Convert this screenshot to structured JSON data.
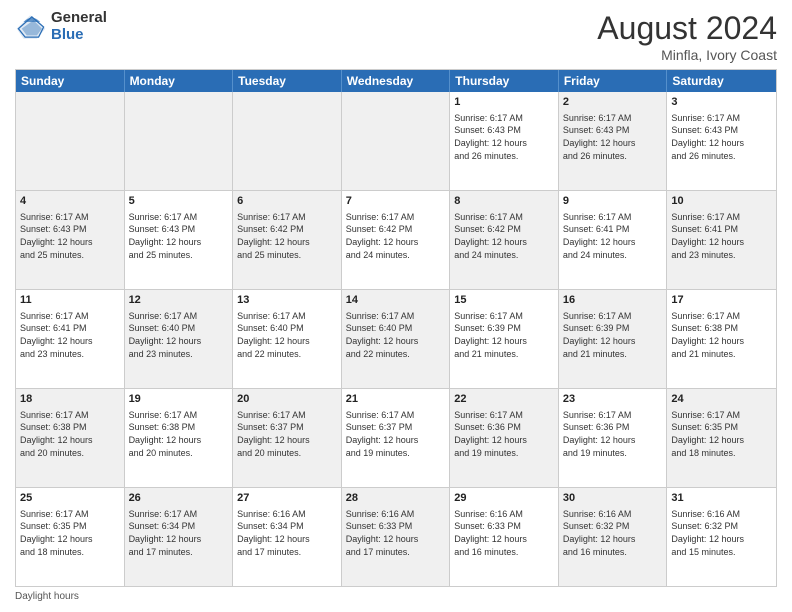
{
  "header": {
    "logo_general": "General",
    "logo_blue": "Blue",
    "title": "August 2024",
    "location": "Minfla, Ivory Coast"
  },
  "days_of_week": [
    "Sunday",
    "Monday",
    "Tuesday",
    "Wednesday",
    "Thursday",
    "Friday",
    "Saturday"
  ],
  "weeks": [
    [
      {
        "day": "",
        "info": "",
        "shaded": true
      },
      {
        "day": "",
        "info": "",
        "shaded": true
      },
      {
        "day": "",
        "info": "",
        "shaded": true
      },
      {
        "day": "",
        "info": "",
        "shaded": true
      },
      {
        "day": "1",
        "info": "Sunrise: 6:17 AM\nSunset: 6:43 PM\nDaylight: 12 hours\nand 26 minutes.",
        "shaded": false
      },
      {
        "day": "2",
        "info": "Sunrise: 6:17 AM\nSunset: 6:43 PM\nDaylight: 12 hours\nand 26 minutes.",
        "shaded": true
      },
      {
        "day": "3",
        "info": "Sunrise: 6:17 AM\nSunset: 6:43 PM\nDaylight: 12 hours\nand 26 minutes.",
        "shaded": false
      }
    ],
    [
      {
        "day": "4",
        "info": "Sunrise: 6:17 AM\nSunset: 6:43 PM\nDaylight: 12 hours\nand 25 minutes.",
        "shaded": true
      },
      {
        "day": "5",
        "info": "Sunrise: 6:17 AM\nSunset: 6:43 PM\nDaylight: 12 hours\nand 25 minutes.",
        "shaded": false
      },
      {
        "day": "6",
        "info": "Sunrise: 6:17 AM\nSunset: 6:42 PM\nDaylight: 12 hours\nand 25 minutes.",
        "shaded": true
      },
      {
        "day": "7",
        "info": "Sunrise: 6:17 AM\nSunset: 6:42 PM\nDaylight: 12 hours\nand 24 minutes.",
        "shaded": false
      },
      {
        "day": "8",
        "info": "Sunrise: 6:17 AM\nSunset: 6:42 PM\nDaylight: 12 hours\nand 24 minutes.",
        "shaded": true
      },
      {
        "day": "9",
        "info": "Sunrise: 6:17 AM\nSunset: 6:41 PM\nDaylight: 12 hours\nand 24 minutes.",
        "shaded": false
      },
      {
        "day": "10",
        "info": "Sunrise: 6:17 AM\nSunset: 6:41 PM\nDaylight: 12 hours\nand 23 minutes.",
        "shaded": true
      }
    ],
    [
      {
        "day": "11",
        "info": "Sunrise: 6:17 AM\nSunset: 6:41 PM\nDaylight: 12 hours\nand 23 minutes.",
        "shaded": false
      },
      {
        "day": "12",
        "info": "Sunrise: 6:17 AM\nSunset: 6:40 PM\nDaylight: 12 hours\nand 23 minutes.",
        "shaded": true
      },
      {
        "day": "13",
        "info": "Sunrise: 6:17 AM\nSunset: 6:40 PM\nDaylight: 12 hours\nand 22 minutes.",
        "shaded": false
      },
      {
        "day": "14",
        "info": "Sunrise: 6:17 AM\nSunset: 6:40 PM\nDaylight: 12 hours\nand 22 minutes.",
        "shaded": true
      },
      {
        "day": "15",
        "info": "Sunrise: 6:17 AM\nSunset: 6:39 PM\nDaylight: 12 hours\nand 21 minutes.",
        "shaded": false
      },
      {
        "day": "16",
        "info": "Sunrise: 6:17 AM\nSunset: 6:39 PM\nDaylight: 12 hours\nand 21 minutes.",
        "shaded": true
      },
      {
        "day": "17",
        "info": "Sunrise: 6:17 AM\nSunset: 6:38 PM\nDaylight: 12 hours\nand 21 minutes.",
        "shaded": false
      }
    ],
    [
      {
        "day": "18",
        "info": "Sunrise: 6:17 AM\nSunset: 6:38 PM\nDaylight: 12 hours\nand 20 minutes.",
        "shaded": true
      },
      {
        "day": "19",
        "info": "Sunrise: 6:17 AM\nSunset: 6:38 PM\nDaylight: 12 hours\nand 20 minutes.",
        "shaded": false
      },
      {
        "day": "20",
        "info": "Sunrise: 6:17 AM\nSunset: 6:37 PM\nDaylight: 12 hours\nand 20 minutes.",
        "shaded": true
      },
      {
        "day": "21",
        "info": "Sunrise: 6:17 AM\nSunset: 6:37 PM\nDaylight: 12 hours\nand 19 minutes.",
        "shaded": false
      },
      {
        "day": "22",
        "info": "Sunrise: 6:17 AM\nSunset: 6:36 PM\nDaylight: 12 hours\nand 19 minutes.",
        "shaded": true
      },
      {
        "day": "23",
        "info": "Sunrise: 6:17 AM\nSunset: 6:36 PM\nDaylight: 12 hours\nand 19 minutes.",
        "shaded": false
      },
      {
        "day": "24",
        "info": "Sunrise: 6:17 AM\nSunset: 6:35 PM\nDaylight: 12 hours\nand 18 minutes.",
        "shaded": true
      }
    ],
    [
      {
        "day": "25",
        "info": "Sunrise: 6:17 AM\nSunset: 6:35 PM\nDaylight: 12 hours\nand 18 minutes.",
        "shaded": false
      },
      {
        "day": "26",
        "info": "Sunrise: 6:17 AM\nSunset: 6:34 PM\nDaylight: 12 hours\nand 17 minutes.",
        "shaded": true
      },
      {
        "day": "27",
        "info": "Sunrise: 6:16 AM\nSunset: 6:34 PM\nDaylight: 12 hours\nand 17 minutes.",
        "shaded": false
      },
      {
        "day": "28",
        "info": "Sunrise: 6:16 AM\nSunset: 6:33 PM\nDaylight: 12 hours\nand 17 minutes.",
        "shaded": true
      },
      {
        "day": "29",
        "info": "Sunrise: 6:16 AM\nSunset: 6:33 PM\nDaylight: 12 hours\nand 16 minutes.",
        "shaded": false
      },
      {
        "day": "30",
        "info": "Sunrise: 6:16 AM\nSunset: 6:32 PM\nDaylight: 12 hours\nand 16 minutes.",
        "shaded": true
      },
      {
        "day": "31",
        "info": "Sunrise: 6:16 AM\nSunset: 6:32 PM\nDaylight: 12 hours\nand 15 minutes.",
        "shaded": false
      }
    ]
  ],
  "footer": "Daylight hours"
}
